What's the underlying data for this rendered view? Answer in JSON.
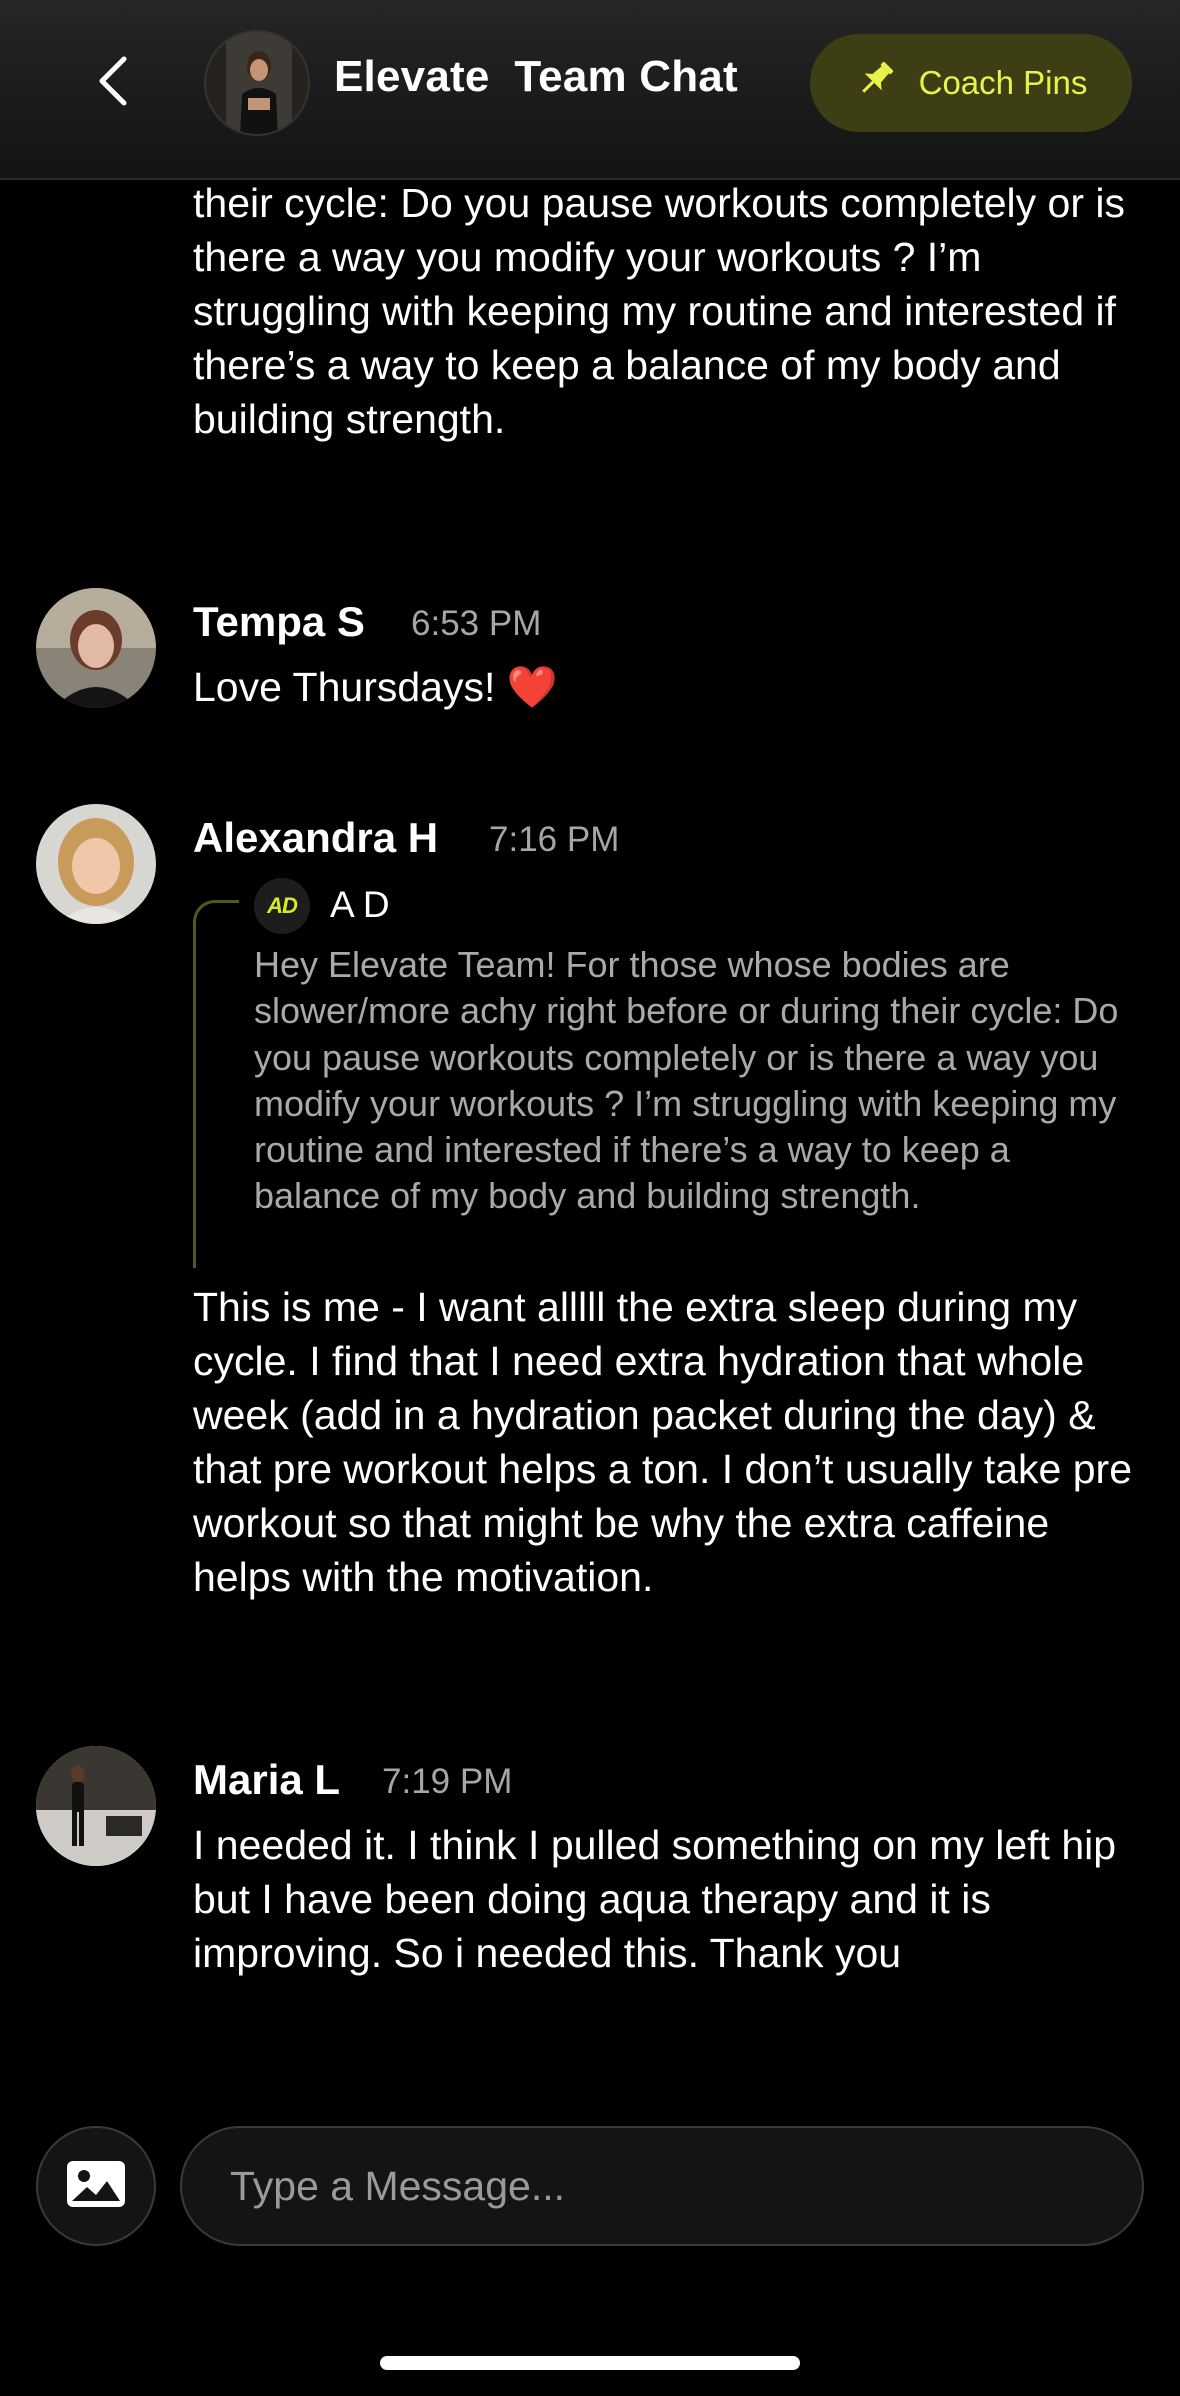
{
  "header": {
    "title": "Elevate  Team Chat",
    "pins_label": "Coach Pins",
    "back_icon": "chevron-left-icon",
    "pin_icon": "pushpin-icon"
  },
  "messages": {
    "continued_text": "their cycle: Do you pause workouts completely or is there a way you modify your workouts ? I’m struggling with keeping my routine and interested if there’s a way to keep a balance of my body and building strength.",
    "tempa": {
      "name": "Tempa S",
      "time": "6:53 PM",
      "text": "Love Thursdays! ❤️"
    },
    "alexandra": {
      "name": "Alexandra H",
      "time": "7:16 PM",
      "reply": {
        "badge": "AD",
        "name": "A D",
        "text": "Hey Elevate Team! For those whose bodies are slower/more achy right before or during their cycle: Do you pause workouts completely or is there a way you modify your workouts ? I’m struggling with keeping my routine and interested if there’s a way to keep a balance of my body and building strength."
      },
      "text": "This is me - I want alllll the extra sleep during my cycle. I find that I need extra hydration that whole week (add in a hydration packet during the day) & that pre workout helps a ton. I don’t usually take pre workout so that might be why the extra caffeine helps with the motivation."
    },
    "maria": {
      "name": "Maria L",
      "time": "7:19 PM",
      "text": "I needed it. I think I pulled something on my left hip but I have been doing aqua therapy and it is improving. So i needed this. Thank you"
    }
  },
  "composer": {
    "placeholder": "Type a Message...",
    "image_icon": "image-icon"
  },
  "colors": {
    "accent": "#e9f24a",
    "pins_bg": "#3d3e13",
    "reply_line": "#4c5a1b",
    "timestamp": "#a6a6a6"
  }
}
